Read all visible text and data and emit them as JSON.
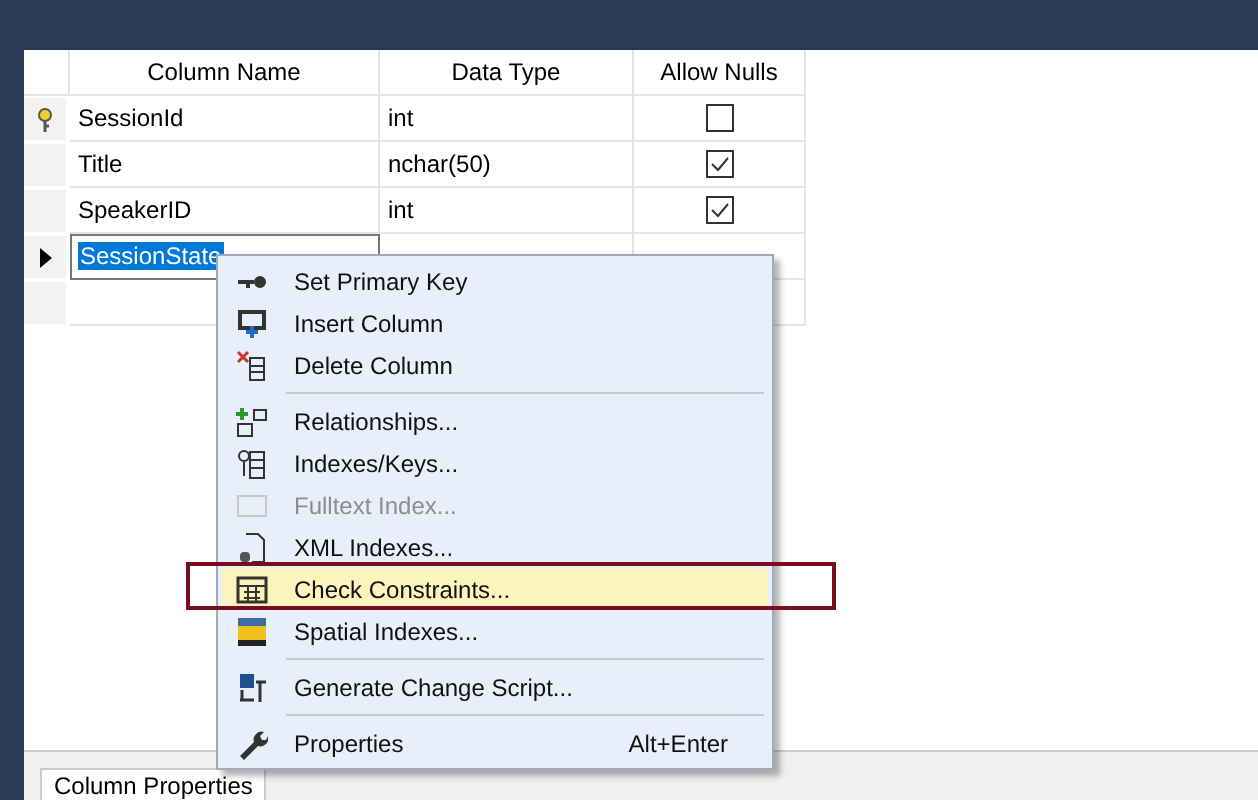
{
  "table": {
    "columns": [
      "Column Name",
      "Data Type",
      "Allow Nulls"
    ],
    "rows": [
      {
        "name": "SessionId",
        "data_type": "int",
        "allow_nulls": false,
        "primary_key": true,
        "current": false
      },
      {
        "name": "Title",
        "data_type": "nchar(50)",
        "allow_nulls": true,
        "primary_key": false,
        "current": false
      },
      {
        "name": "SpeakerID",
        "data_type": "int",
        "allow_nulls": true,
        "primary_key": false,
        "current": false
      },
      {
        "name": "SessionState",
        "primary_key": false,
        "current": true
      }
    ]
  },
  "context_menu": {
    "items": [
      {
        "kind": "item",
        "label": "Set Primary Key",
        "disabled": false,
        "selected": false
      },
      {
        "kind": "item",
        "label": "Insert Column",
        "disabled": false,
        "selected": false
      },
      {
        "kind": "item",
        "label": "Delete Column",
        "disabled": false,
        "selected": false
      },
      {
        "kind": "separator"
      },
      {
        "kind": "item",
        "label": "Relationships...",
        "disabled": false,
        "selected": false
      },
      {
        "kind": "item",
        "label": "Indexes/Keys...",
        "disabled": false,
        "selected": false
      },
      {
        "kind": "item",
        "label": "Fulltext Index...",
        "disabled": true,
        "selected": false
      },
      {
        "kind": "item",
        "label": "XML Indexes...",
        "disabled": false,
        "selected": false
      },
      {
        "kind": "item",
        "label": "Check Constraints...",
        "disabled": false,
        "selected": true
      },
      {
        "kind": "item",
        "label": "Spatial Indexes...",
        "disabled": false,
        "selected": false
      },
      {
        "kind": "separator"
      },
      {
        "kind": "item",
        "label": "Generate Change Script...",
        "disabled": false,
        "selected": false
      },
      {
        "kind": "separator"
      },
      {
        "kind": "item",
        "label": "Properties",
        "shortcut": "Alt+Enter",
        "disabled": false,
        "selected": false
      }
    ]
  },
  "bottom_tabs": [
    "Column Properties"
  ]
}
